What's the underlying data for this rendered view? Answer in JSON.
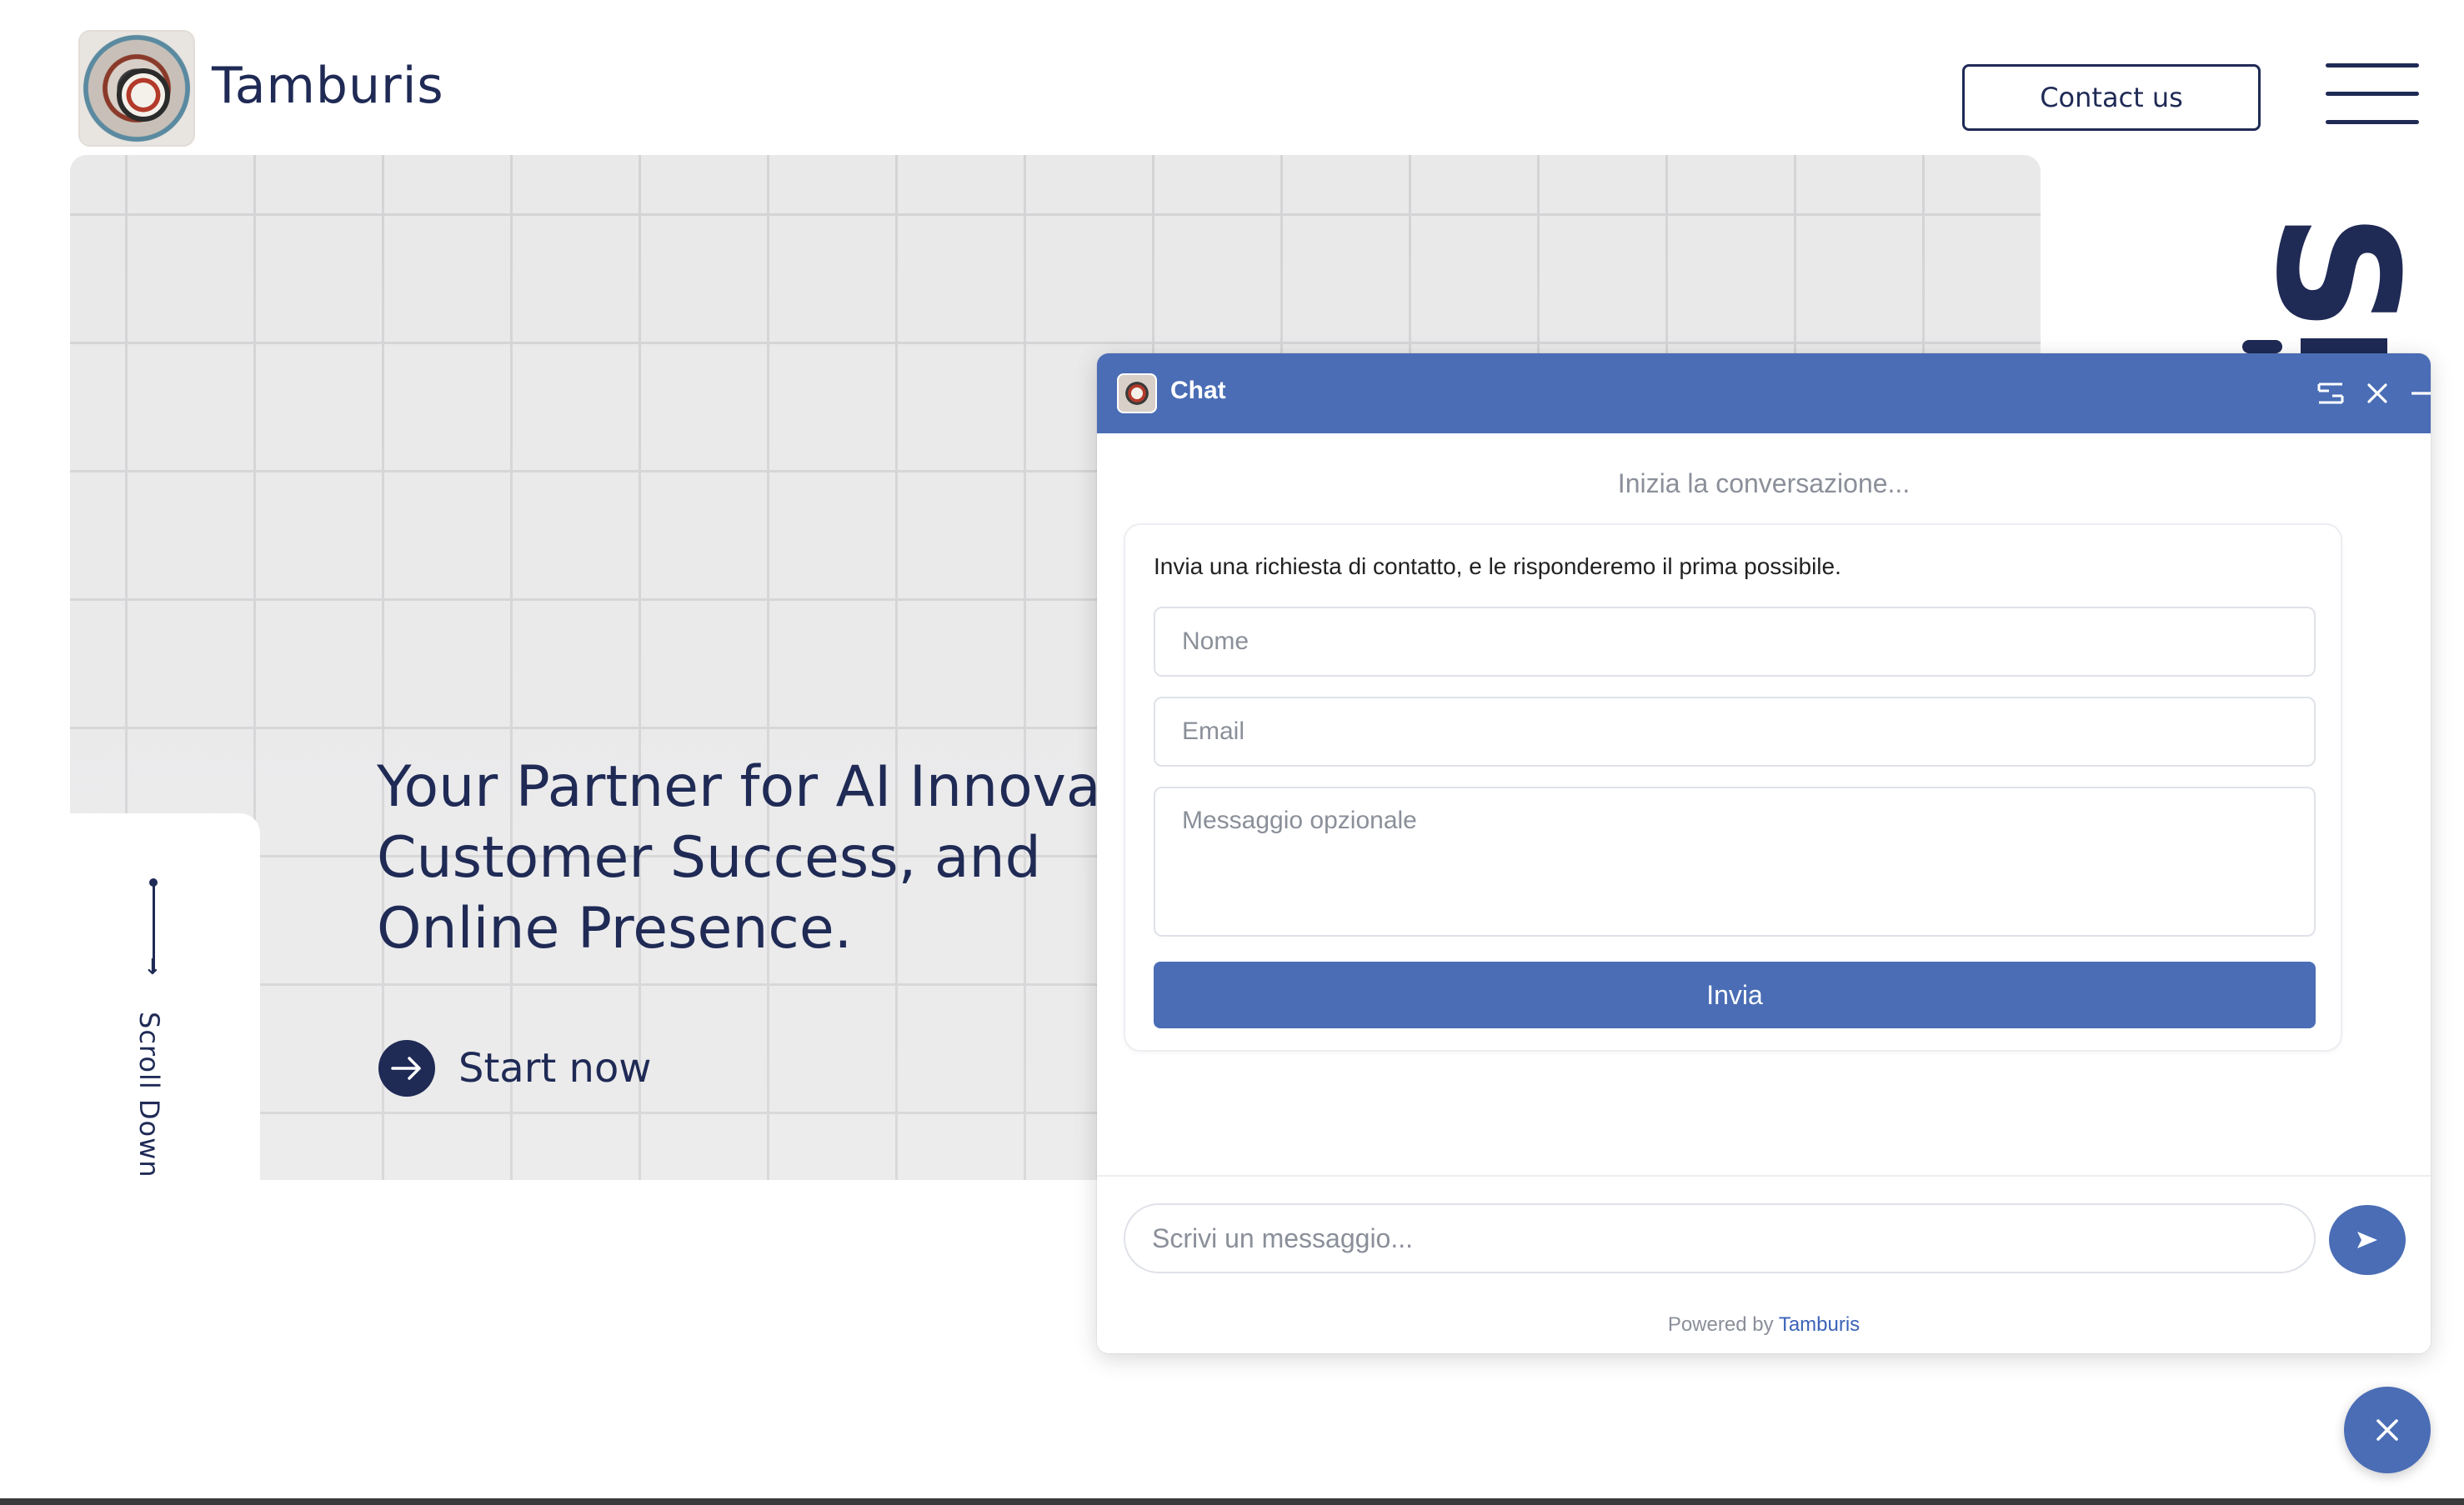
{
  "header": {
    "brand_name": "Tamburis",
    "contact_label": "Contact us"
  },
  "hero": {
    "title_lines": [
      "Your Partner for AI Innovation,",
      "Customer Success, and",
      "Online Presence."
    ],
    "cta_label": "Start now",
    "scroll_label": "Scroll Down"
  },
  "chat": {
    "title": "Chat",
    "start_hint": "Inizia la conversazione...",
    "form": {
      "intro": "Invia una richiesta di contatto, e le risponderemo il prima possibile.",
      "name_placeholder": "Nome",
      "email_placeholder": "Email",
      "message_placeholder": "Messaggio opzionale",
      "submit_label": "Invia"
    },
    "message_placeholder": "Scrivi un messaggio...",
    "powered_by_prefix": "Powered by",
    "powered_by_brand": "Tamburis"
  },
  "icons": {
    "menu": "hamburger-menu-icon",
    "cta": "arrow-right-icon",
    "expand": "expand-icon",
    "close": "close-icon",
    "minimize": "minimize-icon",
    "send": "send-icon",
    "fab": "close-icon"
  },
  "colors": {
    "brand_navy": "#1f2a55",
    "chat_blue": "#4a6db5",
    "link_blue": "#3b63b8"
  }
}
